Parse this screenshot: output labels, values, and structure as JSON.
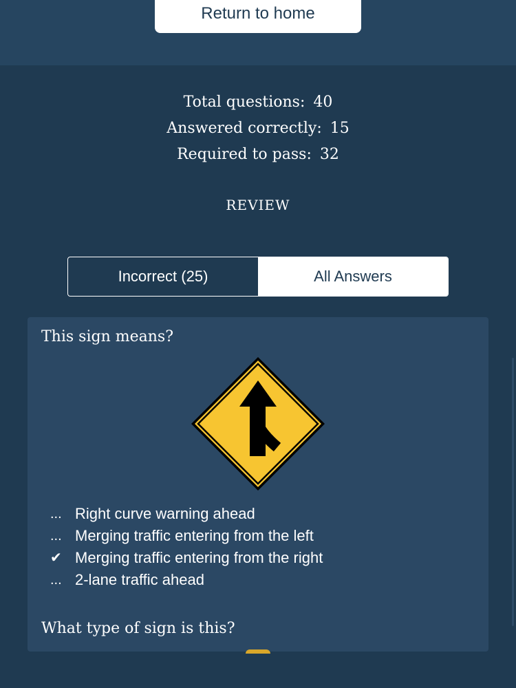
{
  "header": {
    "home_button_label": "Return to home"
  },
  "stats": {
    "total_label": "Total questions:",
    "total_value": "40",
    "correct_label": "Answered correctly:",
    "correct_value": "15",
    "pass_label": "Required to pass:",
    "pass_value": "32"
  },
  "review_heading": "REVIEW",
  "tabs": [
    {
      "label": "Incorrect (25)",
      "selected": false
    },
    {
      "label": "All Answers",
      "selected": true
    }
  ],
  "questions": [
    {
      "prompt": "This sign means?",
      "sign_icon": "merging-traffic-right-sign-icon",
      "answers": [
        {
          "marker": "...",
          "text": "Right curve warning ahead",
          "correct": false
        },
        {
          "marker": "...",
          "text": "Merging traffic entering from the left",
          "correct": false
        },
        {
          "marker": "✔",
          "text": "Merging traffic entering from the right",
          "correct": true
        },
        {
          "marker": "...",
          "text": "2-lane traffic ahead",
          "correct": false
        }
      ]
    },
    {
      "prompt": "What type of sign is this?"
    }
  ],
  "colors": {
    "background": "#1f3a51",
    "header_band": "#264560",
    "card": "#2b4864",
    "sign_yellow": "#f7c531",
    "text": "#ffffff"
  }
}
